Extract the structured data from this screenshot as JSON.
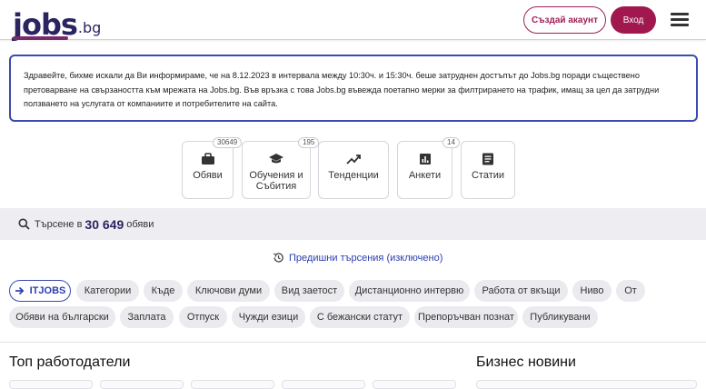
{
  "header": {
    "logo_main": "jobs",
    "logo_tld": ".bg",
    "create_account_label": "Създай акаунт",
    "login_label": "Вход",
    "accent_color": "#a0184e"
  },
  "notice": {
    "text": "Здравейте, бихме искали да Ви информираме, че на 8.12.2023 в интервала между 10:30ч. и 15:30ч. беше затруднен достъпът до Jobs.bg поради съществено претоварване на свързаността към мрежата на Jobs.bg. Във връзка с това Jobs.bg въвежда поетапно мерки за филтрирането на трафик, имащ за цел да затрудни ползването на услугата от компаниите и потребителите на сайта."
  },
  "tiles": [
    {
      "label": "Обяви",
      "badge": "30649",
      "icon": "briefcase-icon"
    },
    {
      "label": "Обучения и Събития",
      "badge": "195",
      "icon": "graduation-cap-icon"
    },
    {
      "label": "Тенденции",
      "badge": "",
      "icon": "trending-up-icon"
    },
    {
      "label": "Анкети",
      "badge": "14",
      "icon": "bar-chart-icon"
    },
    {
      "label": "Статии",
      "badge": "",
      "icon": "article-icon"
    }
  ],
  "search": {
    "prefix": "Търсене в",
    "count": "30 649",
    "suffix": "обяви"
  },
  "previous_searches_label": "Предишни търсения (изключено)",
  "filters": {
    "active": "ITJOBS",
    "row1": [
      "Категории",
      "Къде",
      "Ключови думи",
      "Вид заетост",
      "Дистанционно интервю",
      "Работа от вкъщи",
      "Ниво",
      "От"
    ],
    "row2": [
      "Обяви на български",
      "Заплата",
      "Отпуск",
      "Чужди езици",
      "С бежански статут",
      "Препоръчван познат",
      "Публикувани"
    ]
  },
  "sections": {
    "top_employers": "Топ работодатели",
    "business_news": "Бизнес новини"
  }
}
